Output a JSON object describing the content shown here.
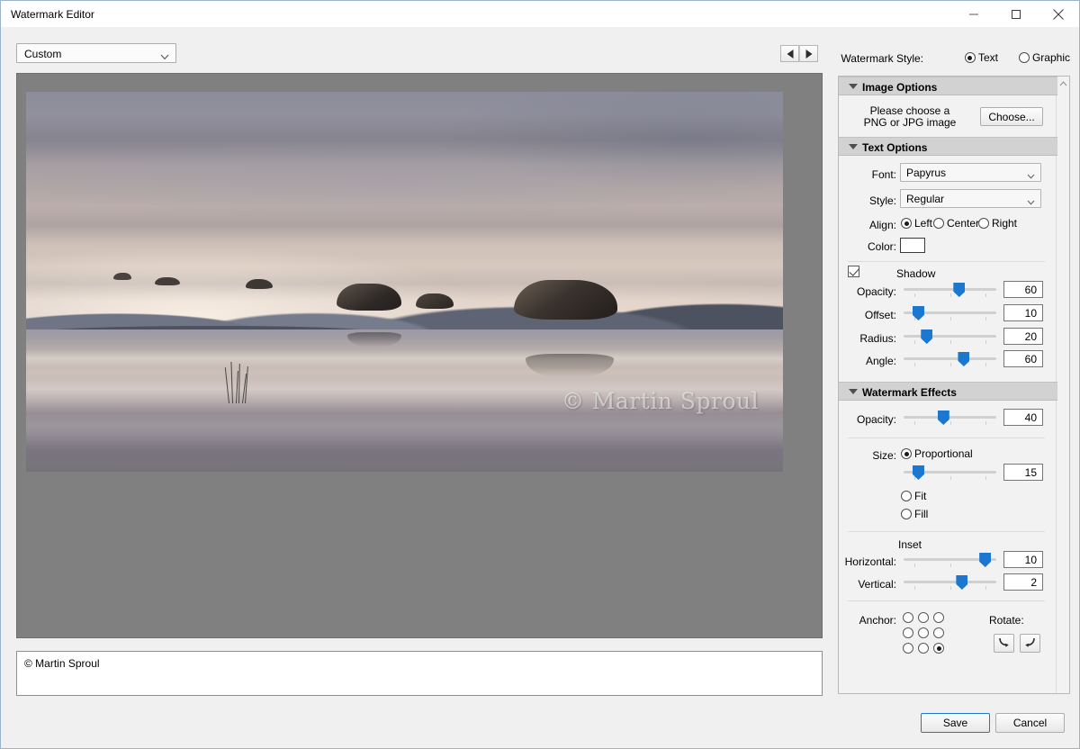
{
  "window": {
    "title": "Watermark Editor",
    "minimize_icon": "minimize-icon",
    "maximize_icon": "maximize-icon",
    "close_icon": "close-icon"
  },
  "toolbar": {
    "preset": "Custom",
    "preset_options": [
      "Custom"
    ],
    "prev_label": "◀",
    "next_label": "▶"
  },
  "preview": {
    "watermark_text": "© Martin Sproul",
    "canvas_color": "#808080"
  },
  "text_entry": {
    "value": "© Martin Sproul"
  },
  "watermark_style": {
    "label": "Watermark Style:",
    "options": [
      "Text",
      "Graphic"
    ],
    "selected": "Text"
  },
  "image_options": {
    "title": "Image Options",
    "hint_line1": "Please choose a",
    "hint_line2": "PNG or JPG image",
    "choose_label": "Choose..."
  },
  "text_options": {
    "title": "Text Options",
    "font_label": "Font:",
    "font_value": "Papyrus",
    "style_label": "Style:",
    "style_value": "Regular",
    "align_label": "Align:",
    "align_options": [
      "Left",
      "Center",
      "Right"
    ],
    "align_selected": "Left",
    "color_label": "Color:",
    "color_value": "#ffffff",
    "shadow_label": "Shadow",
    "shadow_enabled": true,
    "shadow": [
      {
        "label": "Opacity:",
        "value": 60,
        "min": 0,
        "max": 100
      },
      {
        "label": "Offset:",
        "value": 10,
        "min": 0,
        "max": 100
      },
      {
        "label": "Radius:",
        "value": 20,
        "min": 0,
        "max": 100
      },
      {
        "label": "Angle:",
        "value": 60,
        "min": 0,
        "max": 180
      }
    ]
  },
  "watermark_effects": {
    "title": "Watermark Effects",
    "opacity_label": "Opacity:",
    "opacity_value": 40,
    "size_label": "Size:",
    "size_options": [
      "Proportional",
      "Fit",
      "Fill"
    ],
    "size_selected": "Proportional",
    "size_value": 15,
    "inset_label": "Inset",
    "horizontal_label": "Horizontal:",
    "horizontal_value": 10,
    "vertical_label": "Vertical:",
    "vertical_value": 2,
    "anchor_label": "Anchor:",
    "anchor_selected": "bottom-right",
    "rotate_label": "Rotate:",
    "rotate_left_icon": "rotate-left-icon",
    "rotate_right_icon": "rotate-right-icon"
  },
  "footer": {
    "save_label": "Save",
    "cancel_label": "Cancel"
  },
  "colors": {
    "accent": "#1b77cf",
    "panel_bg": "#f2f2f2",
    "section_header": "#d2d2d2"
  }
}
